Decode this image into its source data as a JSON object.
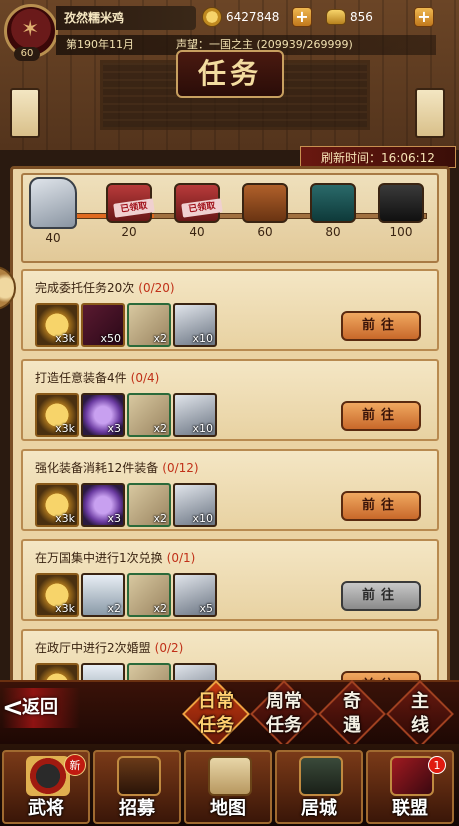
{
  "header": {
    "player_name": "孜然糯米鸡",
    "level": "60",
    "coins": "6427848",
    "ingots": "856",
    "date": "第190年11月",
    "prestige": "声望：一国之主 (209939/269999)",
    "title": "任务",
    "refresh": "刷新时间：16:06:12"
  },
  "progress": {
    "current": 40,
    "start_label": "40",
    "milestones": [
      {
        "label": "20",
        "claimed": true,
        "tag": "已领取"
      },
      {
        "label": "40",
        "claimed": true,
        "tag": "已领取"
      },
      {
        "label": "60",
        "claimed": false,
        "tag": ""
      },
      {
        "label": "80",
        "claimed": false,
        "tag": ""
      },
      {
        "label": "100",
        "claimed": false,
        "tag": ""
      }
    ]
  },
  "quests": [
    {
      "title": "完成委托任务20次",
      "progress": "(0/20)",
      "button": "前往",
      "enabled": true,
      "rewards": [
        {
          "icon": "gold-coin",
          "qty": "x3k"
        },
        {
          "icon": "scroll",
          "qty": "x50"
        },
        {
          "icon": "book",
          "qty": "x2"
        },
        {
          "icon": "horse",
          "qty": "x10"
        }
      ]
    },
    {
      "title": "打造任意装备4件",
      "progress": "(0/4)",
      "button": "前往",
      "enabled": true,
      "rewards": [
        {
          "icon": "gold-coin",
          "qty": "x3k"
        },
        {
          "icon": "purple-star",
          "qty": "x3"
        },
        {
          "icon": "book",
          "qty": "x2"
        },
        {
          "icon": "horse",
          "qty": "x10"
        }
      ]
    },
    {
      "title": "强化装备消耗12件装备",
      "progress": "(0/12)",
      "button": "前往",
      "enabled": true,
      "rewards": [
        {
          "icon": "gold-coin",
          "qty": "x3k"
        },
        {
          "icon": "purple-star",
          "qty": "x3"
        },
        {
          "icon": "book",
          "qty": "x2"
        },
        {
          "icon": "horse",
          "qty": "x10"
        }
      ]
    },
    {
      "title": "在万国集中进行1次兑换",
      "progress": "(0/1)",
      "button": "前往",
      "enabled": false,
      "rewards": [
        {
          "icon": "gold-coin",
          "qty": "x3k"
        },
        {
          "icon": "jar",
          "qty": "x2"
        },
        {
          "icon": "book",
          "qty": "x2"
        },
        {
          "icon": "horse",
          "qty": "x5"
        }
      ]
    },
    {
      "title": "在政厅中进行2次婚盟",
      "progress": "(0/2)",
      "button": "前往",
      "enabled": true,
      "rewards": [
        {
          "icon": "gold-coin",
          "qty": ""
        },
        {
          "icon": "jar",
          "qty": ""
        },
        {
          "icon": "book",
          "qty": ""
        },
        {
          "icon": "horse",
          "qty": ""
        }
      ]
    }
  ],
  "tabs": {
    "back": "返回",
    "items": [
      {
        "label_top": "日常",
        "label_bottom": "任务",
        "active": true
      },
      {
        "label_top": "周常",
        "label_bottom": "任务",
        "active": false
      },
      {
        "label_top": "奇",
        "label_bottom": "遇",
        "active": false
      },
      {
        "label_top": "主",
        "label_bottom": "线",
        "active": false
      }
    ]
  },
  "nav": {
    "items": [
      {
        "label": "武将",
        "badge": "新"
      },
      {
        "label": "招募",
        "badge": ""
      },
      {
        "label": "地图",
        "badge": ""
      },
      {
        "label": "居城",
        "badge": ""
      },
      {
        "label": "联盟",
        "badge": "1"
      }
    ]
  }
}
